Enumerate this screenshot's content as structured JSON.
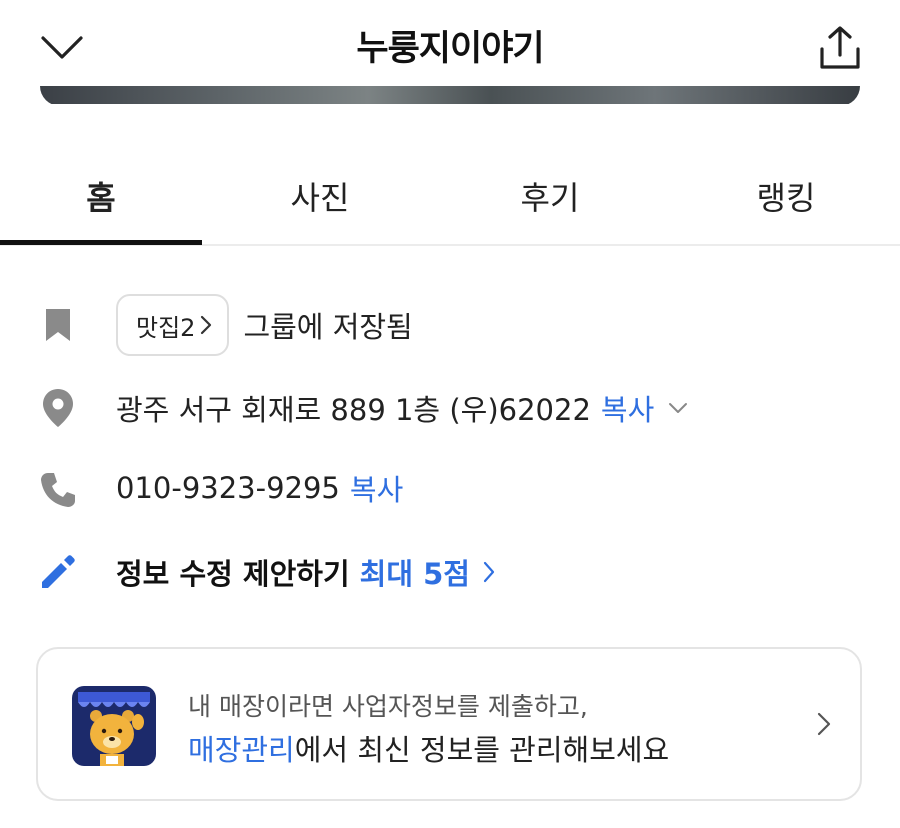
{
  "header": {
    "title": "누룽지이야기",
    "back_icon": "chevron-down-icon",
    "share_icon": "share-icon"
  },
  "tabs": [
    {
      "label": "홈",
      "active": true
    },
    {
      "label": "사진",
      "active": false
    },
    {
      "label": "후기",
      "active": false
    },
    {
      "label": "랭킹",
      "active": false
    }
  ],
  "saved": {
    "icon": "bookmark-icon",
    "chip_label": "맛집2",
    "text": "그룹에 저장됨"
  },
  "address": {
    "icon": "location-pin-icon",
    "text": "광주 서구 회재로 889 1층 (우)62022",
    "copy_label": "복사"
  },
  "phone": {
    "icon": "phone-icon",
    "text": "010-9323-9295",
    "copy_label": "복사"
  },
  "suggest": {
    "icon": "pencil-icon",
    "text": "정보 수정 제안하기",
    "reward": "최대 5점"
  },
  "owner_card": {
    "logo": "store-owner-character-icon",
    "line1": "내 매장이라면 사업자정보를 제출하고,",
    "line2_highlight": "매장관리",
    "line2_rest": "에서 최신 정보를 관리해보세요"
  },
  "colors": {
    "accent": "#2f6fe0",
    "icon_gray": "#8a8a8a",
    "text": "#222222"
  }
}
